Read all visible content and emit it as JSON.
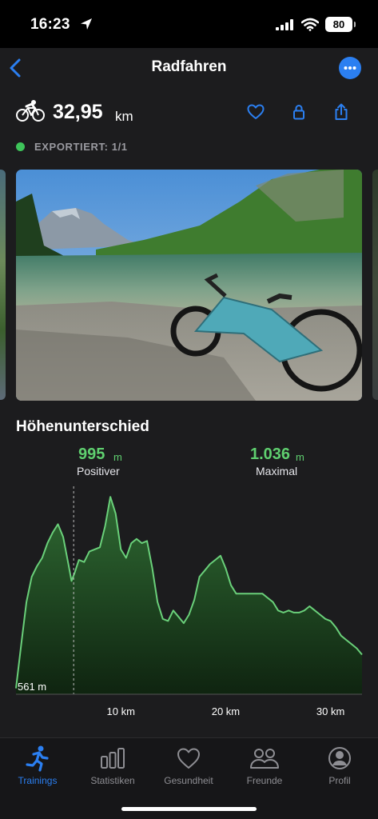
{
  "status_bar": {
    "time": "16:23",
    "battery": "80"
  },
  "nav": {
    "title": "Radfahren"
  },
  "summary": {
    "distance_value": "32,95",
    "distance_unit": "km",
    "export_status": "EXPORTIERT: 1/1",
    "export_color": "#3ec45a"
  },
  "elevation": {
    "title": "Höhenunterschied",
    "positive_value": "995",
    "positive_unit": "m",
    "positive_label": "Positiver",
    "max_value": "1.036",
    "max_unit": "m",
    "max_label": "Maximal",
    "min_label": "561 m",
    "accent_color": "#5fcf6f"
  },
  "chart_data": {
    "type": "area",
    "title": "",
    "xlabel": "",
    "ylabel": "",
    "x_unit": "km",
    "x_ticks": [
      "10 km",
      "20 km",
      "30 km"
    ],
    "xlim": [
      0,
      33
    ],
    "ylim": [
      561,
      1036
    ],
    "marker_x": 5.5,
    "series": [
      {
        "x": [
          0,
          0.5,
          1,
          1.5,
          2,
          2.5,
          3,
          3.5,
          4,
          4.5,
          5,
          5.3,
          5.6,
          6,
          6.5,
          7,
          7.5,
          8,
          8.5,
          9,
          9.5,
          10,
          10.5,
          11,
          11.5,
          12,
          12.5,
          13,
          13.5,
          14,
          14.5,
          15,
          15.5,
          16,
          16.5,
          17,
          17.5,
          18,
          18.5,
          19,
          19.5,
          20,
          20.5,
          21,
          21.5,
          22,
          22.5,
          23,
          23.5,
          24,
          24.5,
          25,
          25.5,
          26,
          26.5,
          27,
          27.5,
          28,
          28.5,
          29,
          29.5,
          30,
          30.5,
          31,
          31.5,
          32,
          32.5,
          33
        ],
        "values": [
          575,
          680,
          780,
          840,
          865,
          885,
          920,
          945,
          965,
          935,
          870,
          830,
          850,
          880,
          875,
          900,
          905,
          910,
          960,
          1030,
          990,
          905,
          885,
          920,
          930,
          920,
          925,
          860,
          780,
          740,
          735,
          760,
          745,
          730,
          750,
          785,
          840,
          855,
          870,
          880,
          890,
          860,
          820,
          800,
          800,
          800,
          800,
          800,
          800,
          790,
          780,
          760,
          755,
          760,
          755,
          755,
          760,
          770,
          760,
          750,
          740,
          735,
          720,
          700,
          690,
          680,
          670,
          655
        ]
      }
    ]
  },
  "tabs": [
    {
      "label": "Trainings",
      "icon": "run-icon",
      "active": true
    },
    {
      "label": "Statistiken",
      "icon": "stats-icon",
      "active": false
    },
    {
      "label": "Gesundheit",
      "icon": "heart-icon",
      "active": false
    },
    {
      "label": "Freunde",
      "icon": "friends-icon",
      "active": false
    },
    {
      "label": "Profil",
      "icon": "profile-icon",
      "active": false
    }
  ],
  "colors": {
    "accent": "#2b7ff1",
    "panel": "#1c1c1e",
    "tab_active": "#2b7ff1",
    "tab_inactive": "#8e8e93"
  }
}
